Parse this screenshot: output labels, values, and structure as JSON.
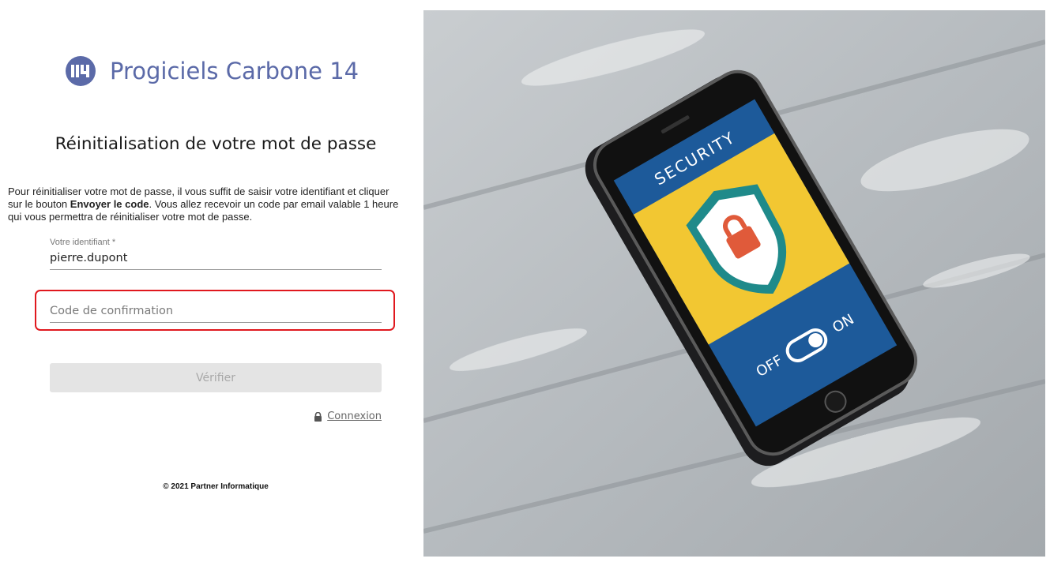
{
  "brand": {
    "name": "Progiciels Carbone 14",
    "logo_icon": "c14-logo-icon"
  },
  "page": {
    "title": "Réinitialisation de votre mot de passe"
  },
  "instructions": {
    "part1": "Pour réinitialiser votre mot de passe, il vous suffit de saisir votre identifiant et cliquer sur le bouton ",
    "bold": "Envoyer le code",
    "part2": ". Vous allez recevoir un code par email valable 1 heure qui vous permettra de réinitialiser votre mot de passe."
  },
  "form": {
    "identifier": {
      "label": "Votre identifiant *",
      "value": "pierre.dupont"
    },
    "confirmation_code": {
      "placeholder": "Code de confirmation",
      "value": ""
    },
    "verify_button": "Vérifier",
    "login_link": "Connexion"
  },
  "footer": {
    "copyright": "© 2021 Partner Informatique"
  },
  "hero": {
    "screen_title": "SECURITY",
    "toggle_off": "OFF",
    "toggle_on": "ON"
  },
  "colors": {
    "brand": "#5b6aa8",
    "highlight": "#e0181e",
    "button_bg": "#e4e4e4",
    "screen_blue": "#1d5a9a",
    "screen_yellow": "#f2c732"
  }
}
